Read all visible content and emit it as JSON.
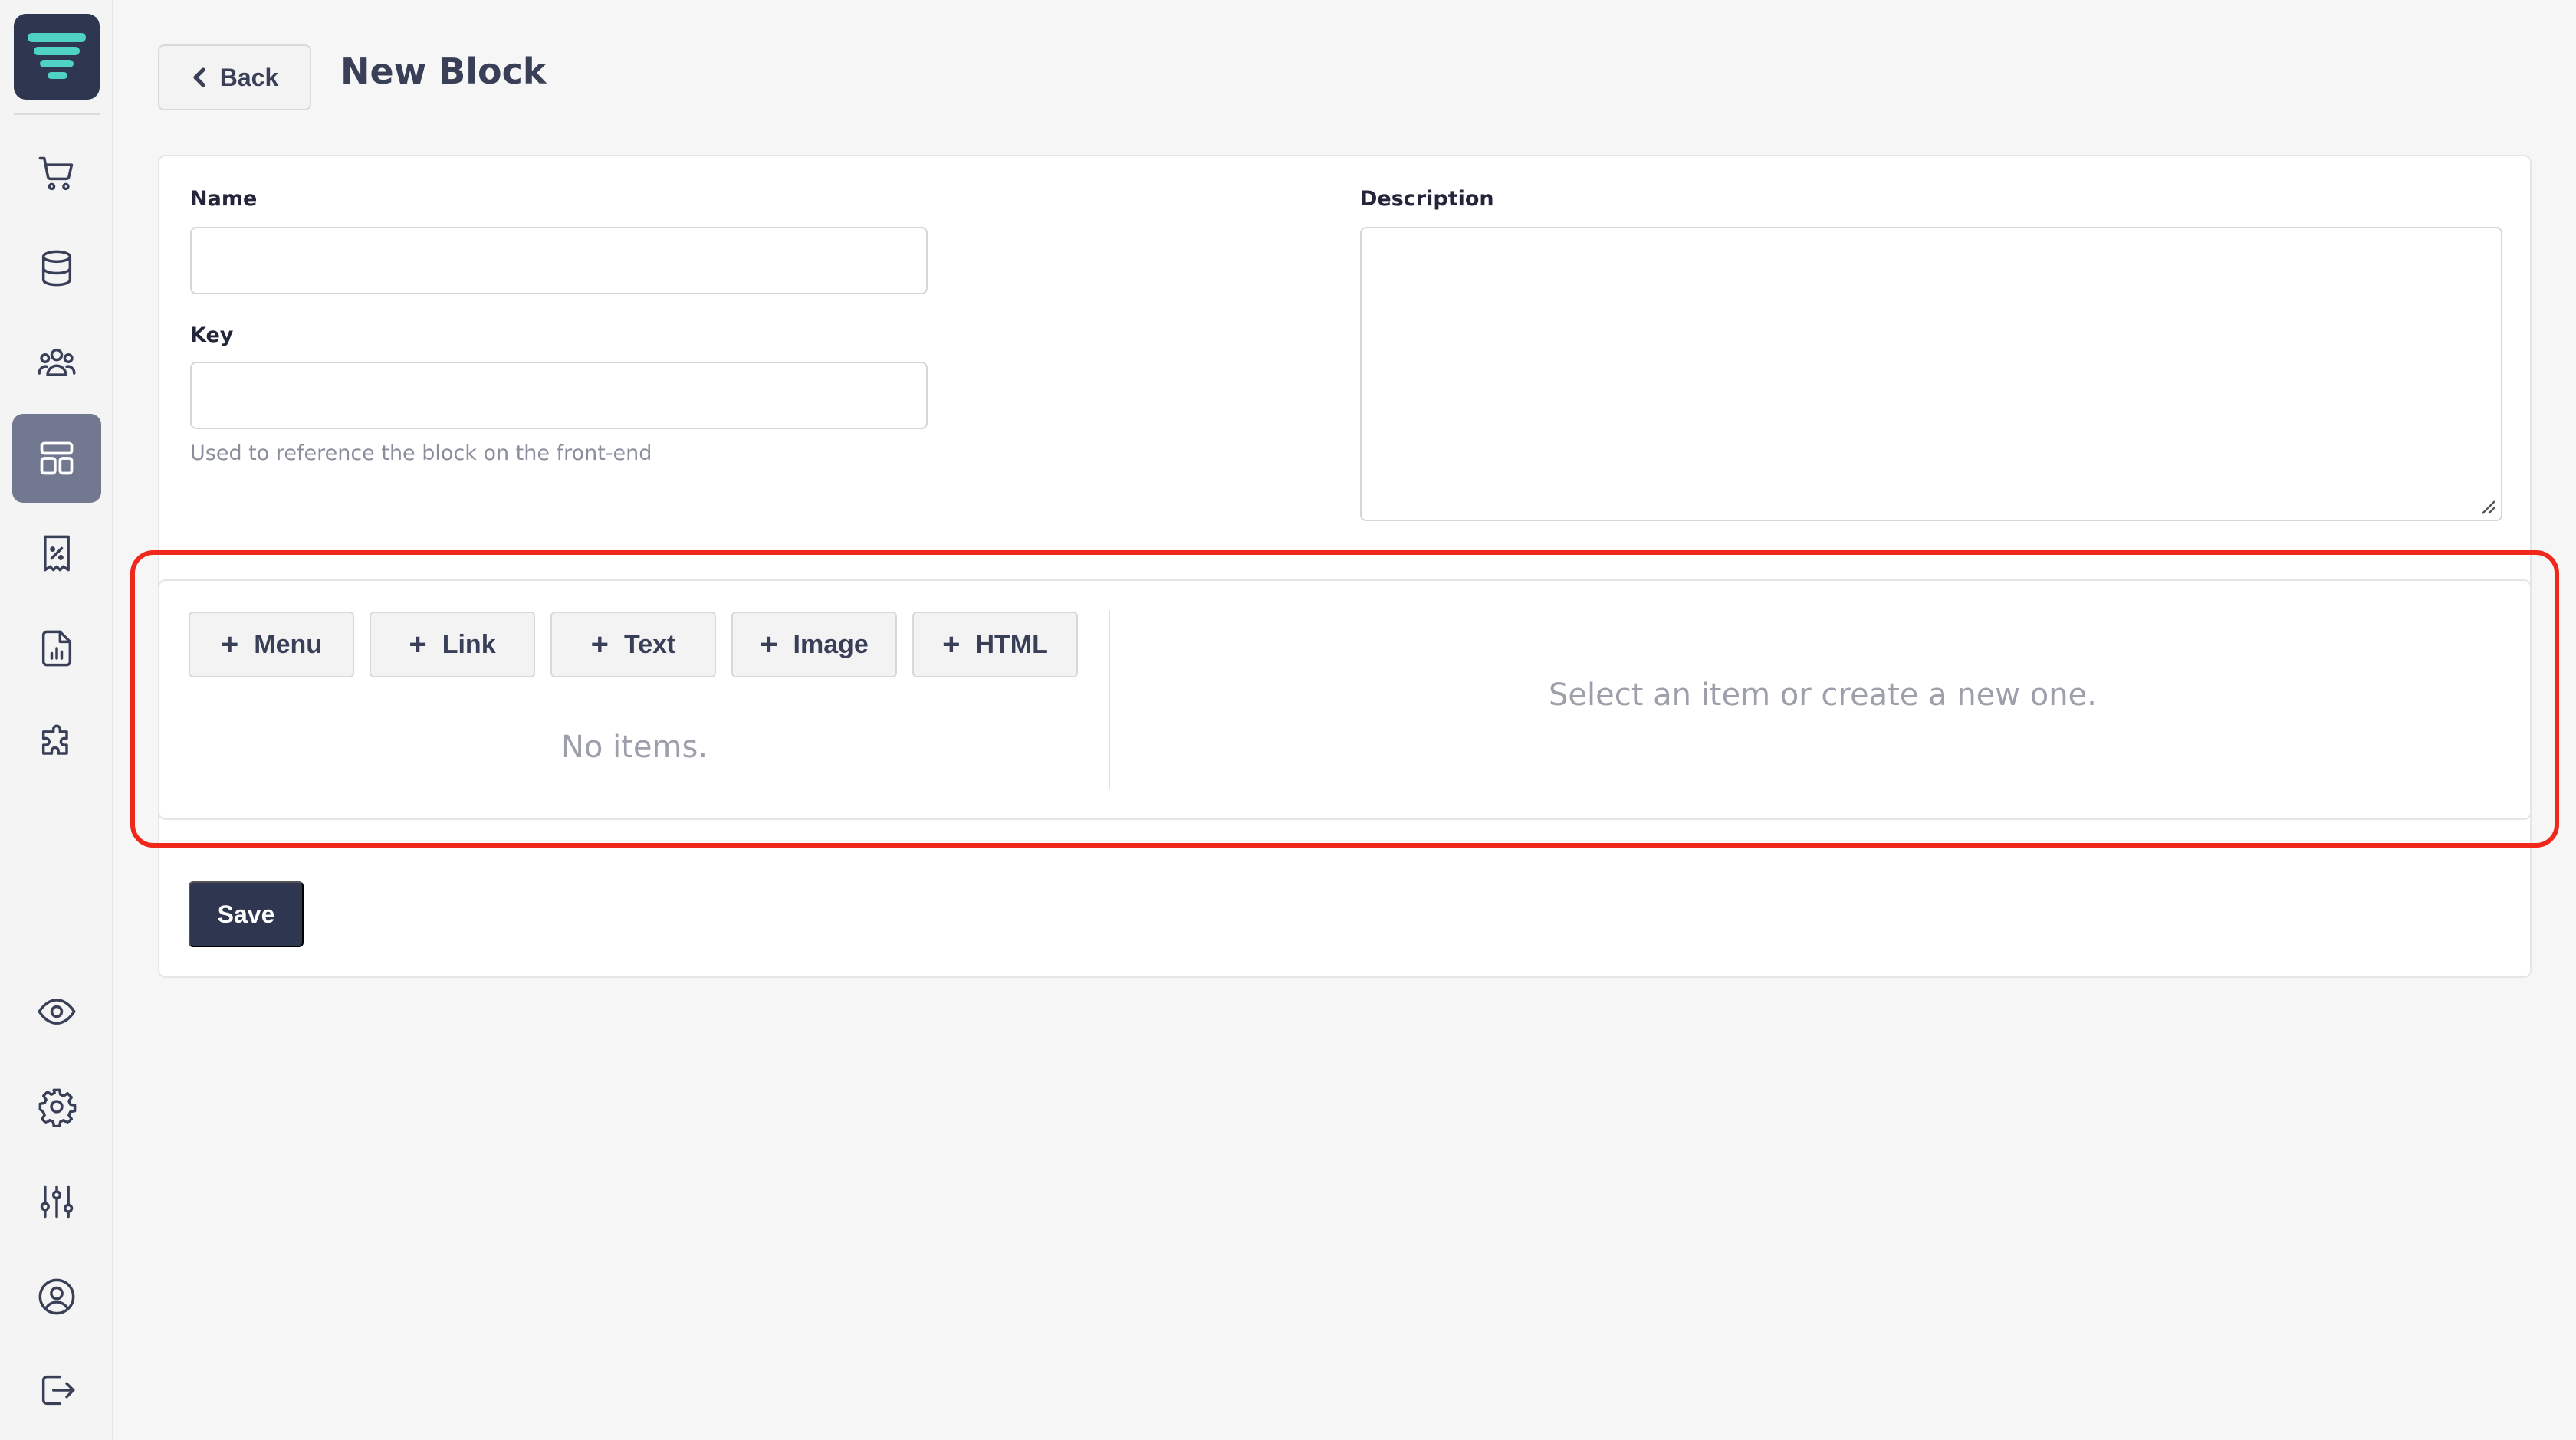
{
  "header": {
    "back_label": "Back",
    "title": "New Block"
  },
  "form": {
    "name_label": "Name",
    "name_value": "",
    "key_label": "Key",
    "key_value": "",
    "key_hint": "Used to reference the block on the front-end",
    "description_label": "Description",
    "description_value": ""
  },
  "items": {
    "add_buttons": [
      "Menu",
      "Link",
      "Text",
      "Image",
      "HTML"
    ],
    "empty_text": "No items.",
    "detail_placeholder": "Select an item or create a new one."
  },
  "actions": {
    "save_label": "Save"
  },
  "sidebar": {
    "items": [
      {
        "icon": "cart-icon"
      },
      {
        "icon": "database-icon"
      },
      {
        "icon": "users-icon"
      },
      {
        "icon": "layout-icon",
        "active": true
      },
      {
        "icon": "receipt-percent-icon"
      },
      {
        "icon": "report-icon"
      },
      {
        "icon": "puzzle-icon"
      },
      {
        "icon": "eye-icon"
      },
      {
        "icon": "gear-icon"
      },
      {
        "icon": "sliders-icon"
      },
      {
        "icon": "user-circle-icon"
      },
      {
        "icon": "logout-icon"
      }
    ]
  },
  "colors": {
    "accent": "#2f3650",
    "highlight": "#f0271b",
    "logo_stripe": "#4fd1c5"
  }
}
